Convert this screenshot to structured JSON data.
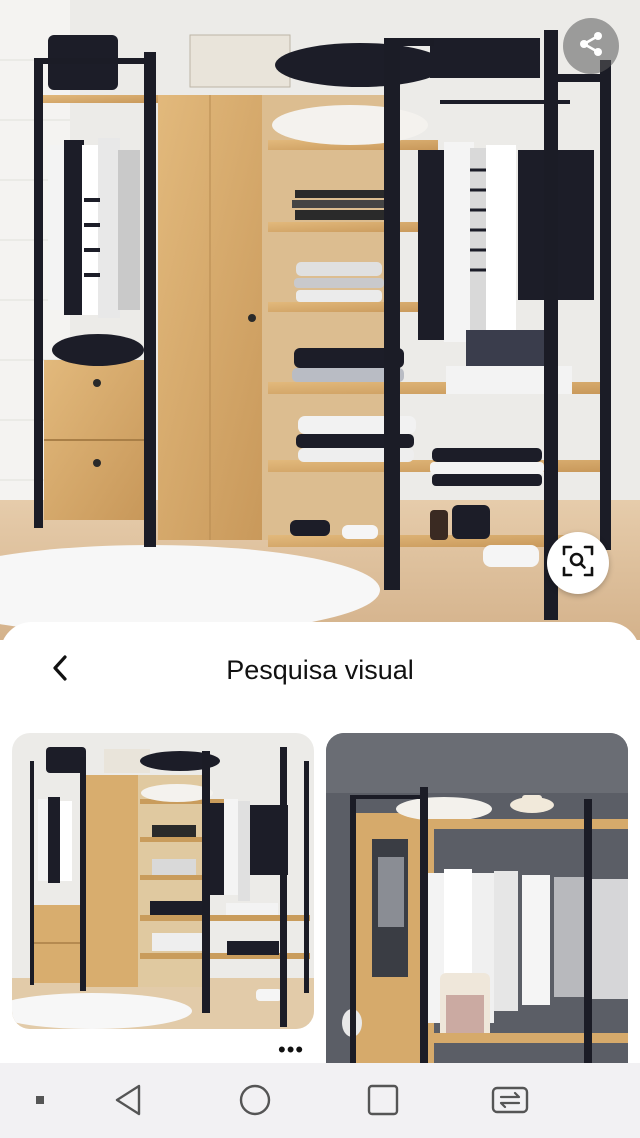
{
  "header": {
    "title": "Pesquisa visual",
    "back_icon": "chevron-left-icon"
  },
  "hero": {
    "image_description": "wardrobe-with-clothes-photo",
    "share_icon": "share-icon",
    "visual_search_icon": "visual-search-lens-icon"
  },
  "results": {
    "items": [
      {
        "image": "wardrobe-thumbnail"
      },
      {
        "image": "wardrobe-with-mirror-thumbnail"
      }
    ],
    "more_label": "•••"
  },
  "navbar": {
    "items": [
      "menu-dot-icon",
      "back-triangle-icon",
      "home-circle-icon",
      "recents-square-icon",
      "switch-app-icon"
    ]
  },
  "colors": {
    "wood": "#d8ad6e",
    "frame": "#1b1c26",
    "wall": "#e9e8e5",
    "floor": "#e0c7a6",
    "navbar": "#f2f1f3"
  }
}
